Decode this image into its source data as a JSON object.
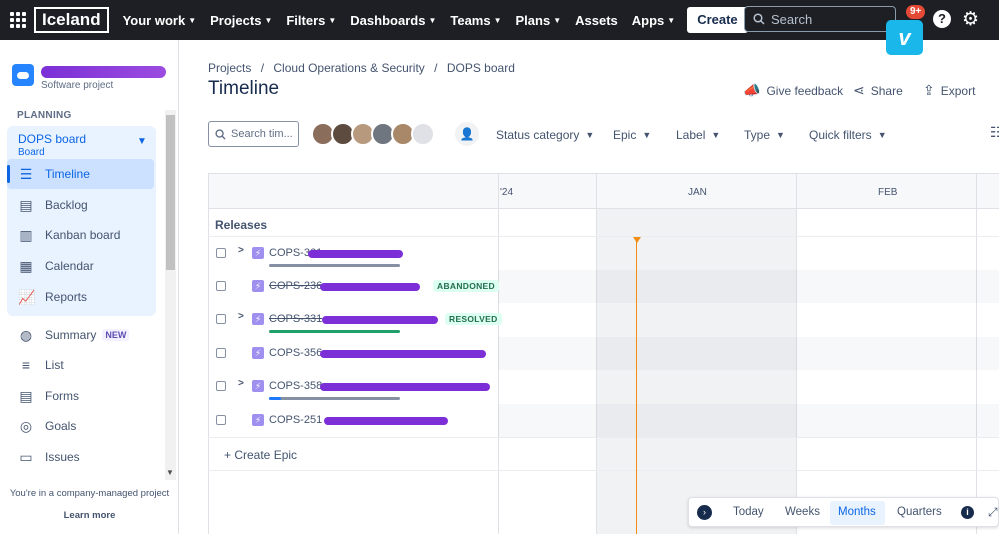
{
  "topbar": {
    "logo": "Iceland",
    "nav": [
      "Your work",
      "Projects",
      "Filters",
      "Dashboards",
      "Teams",
      "Plans",
      "Assets",
      "Apps"
    ],
    "create_label": "Create",
    "search_placeholder": "Search",
    "notif_badge": "9+",
    "vimeo_label": "v"
  },
  "sidebar": {
    "project_type": "Software project",
    "section_label": "PLANNING",
    "board_title": "DOPS board",
    "board_subtitle": "Board",
    "board_items": [
      "Timeline",
      "Backlog",
      "Kanban board",
      "Calendar",
      "Reports"
    ],
    "other_items": [
      {
        "label": "Summary",
        "badge": "NEW"
      },
      {
        "label": "List"
      },
      {
        "label": "Forms"
      },
      {
        "label": "Goals"
      },
      {
        "label": "Issues"
      }
    ],
    "footer_text": "You're in a company-managed project",
    "learn_more": "Learn more"
  },
  "header": {
    "breadcrumb": [
      "Projects",
      "/",
      "Cloud Operations & Security",
      "/",
      "DOPS board"
    ],
    "title": "Timeline",
    "actions": [
      "Give feedback",
      "Share",
      "Export"
    ]
  },
  "toolbar": {
    "search_placeholder": "Search tim...",
    "filters": [
      "Status category",
      "Epic",
      "Label",
      "Type",
      "Quick filters"
    ]
  },
  "timeline": {
    "columns": [
      "'24",
      "JAN",
      "FEB"
    ],
    "releases_label": "Releases",
    "rows": [
      {
        "key": "COPS-361",
        "done": false,
        "status": "",
        "expandable": true
      },
      {
        "key": "COPS-236",
        "done": true,
        "status": "ABANDONED",
        "expandable": false
      },
      {
        "key": "COPS-331",
        "done": true,
        "status": "RESOLVED",
        "expandable": true
      },
      {
        "key": "COPS-356",
        "done": false,
        "status": "",
        "expandable": false
      },
      {
        "key": "COPS-358",
        "done": false,
        "status": "",
        "expandable": true
      },
      {
        "key": "COPS-251",
        "done": false,
        "status": "",
        "expandable": false
      }
    ],
    "create_epic": "+ Create Epic"
  },
  "zoom": {
    "today": "Today",
    "weeks": "Weeks",
    "months": "Months",
    "quarters": "Quarters",
    "selected": "Months"
  },
  "colors": {
    "topbar": "#1d1f24",
    "accent": "#0c66e4",
    "today_line": "#f18d13",
    "resolved_bar": "#22a06b"
  }
}
